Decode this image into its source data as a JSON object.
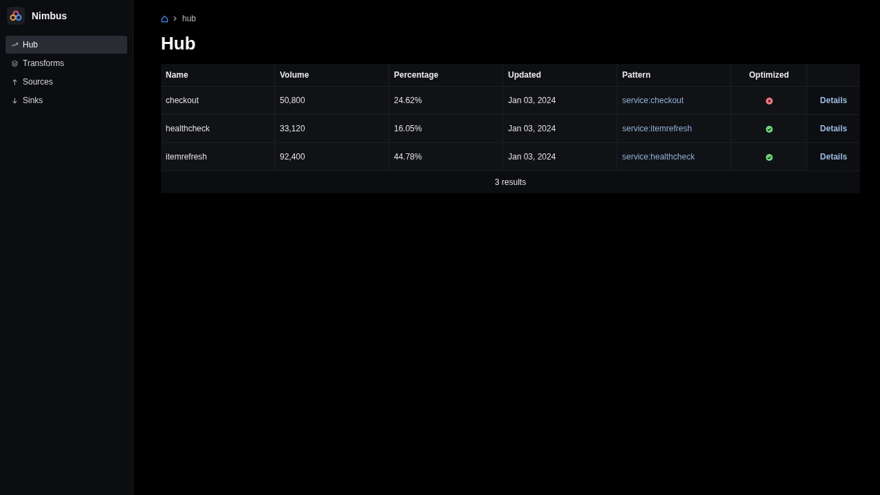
{
  "app": {
    "name": "Nimbus"
  },
  "sidebar": {
    "items": [
      {
        "label": "Hub",
        "selected": true
      },
      {
        "label": "Transforms",
        "selected": false
      },
      {
        "label": "Sources",
        "selected": false
      },
      {
        "label": "Sinks",
        "selected": false
      }
    ]
  },
  "breadcrumb": {
    "current": "hub"
  },
  "page_title": "Hub",
  "table": {
    "columns": [
      "Name",
      "Volume",
      "Percentage",
      "Updated",
      "Pattern",
      "Optimized"
    ],
    "rows": [
      {
        "name": "checkout",
        "volume": "50,800",
        "percentage": "24.62%",
        "updated": "Jan 03, 2024",
        "pattern": "service:checkout",
        "optimized": false,
        "action": "Details"
      },
      {
        "name": "healthcheck",
        "volume": "33,120",
        "percentage": "16.05%",
        "updated": "Jan 03, 2024",
        "pattern": "service:itemrefresh",
        "optimized": true,
        "action": "Details"
      },
      {
        "name": "itemrefresh",
        "volume": "92,400",
        "percentage": "44.78%",
        "updated": "Jan 03, 2024",
        "pattern": "service:healthcheck",
        "optimized": true,
        "action": "Details"
      }
    ],
    "footer": "3 results"
  }
}
